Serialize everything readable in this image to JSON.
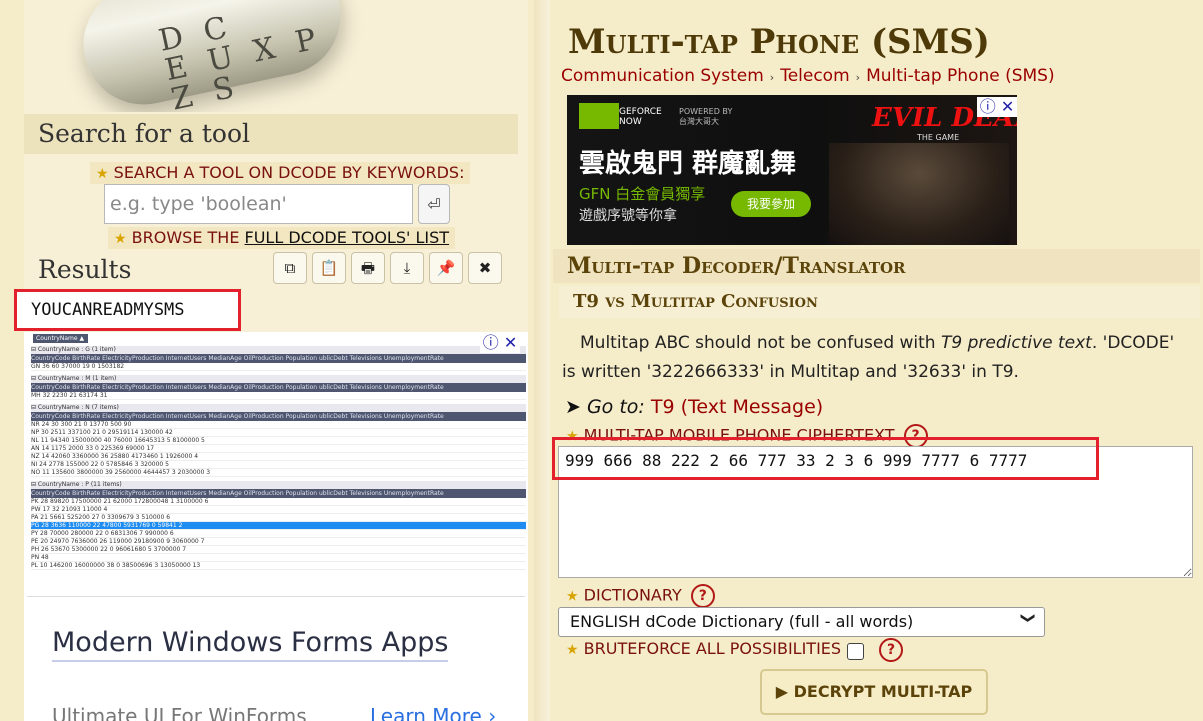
{
  "logo": {
    "letters": "D C\nE U X P\nZ S"
  },
  "search": {
    "section_title": "Search for a tool",
    "keywords_label": "SEARCH A TOOL ON DCODE BY KEYWORDS:",
    "placeholder": "e.g. type 'boolean'",
    "go_icon": "⏎",
    "browse_prefix": "BROWSE THE ",
    "browse_link": "FULL DCODE TOOLS' LIST"
  },
  "results": {
    "section_title": "Results",
    "toolbar_icons": [
      "copy-icon",
      "clipboard-icon",
      "print-icon",
      "download-icon",
      "pin-icon",
      "close-icon"
    ],
    "toolbar_glyphs": [
      "⧉",
      "📋",
      "🖶",
      "⤓",
      "📌",
      "✖"
    ],
    "output": "YOUCANREADMYSMS"
  },
  "ad_left": {
    "dropdown": "CountryName ▲",
    "headers": "CountryCode    BirthRate    ElectricityProduction    InternetUsers    MedianAge    OilProduction    Population    ublicDebt    Televisions    UnemploymentRate",
    "groups": [
      {
        "title": "⊟ CountryName : G (1 item)",
        "rows": [
          "GN        36        60        37000        19        0        1503182"
        ],
        "sel": -1
      },
      {
        "title": "⊟ CountryName : M (1 item)",
        "rows": [
          "MH        32        2230        21        63174        31"
        ],
        "sel": -1
      },
      {
        "title": "⊟ CountryName : N (7 items)",
        "rows": [
          "NR   24   30   300   21   0   13770   500   90",
          "NP   30   2511   337100   21   0   29519114   130000   42",
          "NL   11   94340   15000000   40   76000   16645313   5   8100000   5",
          "AN   14   1175   2000   33   0   225369   69000   17",
          "NZ   14   42060   3360000   36   25880   4173460   1   1926000   4",
          "NI   24   2778   155000   22   0   5785846   3   320000   5",
          "NO   11   135600   3800000   39   2560000   4644457   3   2030000   3"
        ],
        "sel": -1
      },
      {
        "title": "⊟ CountryName : P (11 items)",
        "rows": [
          "PK   28   89820   17500000   21   62000   172800048   1   3100000   6",
          "PW   17   32   21093   11000   4",
          "PA   21   5661   525200   27   0   3309679   3   510000   6",
          "PG   28   3636   110000   22   47800   5931769   0   59841   2",
          "PY   28   70000   280000   22   0   6831306   7   990000   6",
          "PE   20   24970   7636000   26   119000   29180900   9   3060000   7",
          "PH   26   53670   5300000   22   0   96061680   5   3700000   7",
          "PN   48",
          "PL   10   146200   16000000   38   0   38500696   3   13050000   13"
        ],
        "sel": 3
      }
    ],
    "title": "Modern Windows Forms Apps",
    "subtitle": "Ultimate UI For WinForms",
    "more": "Learn More ›",
    "adchoice": "ⓘ ✕"
  },
  "page": {
    "title": "Multi-tap Phone (SMS)",
    "breadcrumb": [
      "Communication System",
      "Telecom",
      "Multi-tap Phone (SMS)"
    ],
    "breadcrumb_sep": "›"
  },
  "ad_right": {
    "brand1": "GEFORCE\nNOW",
    "powered": "POWERED BY\n台灣大哥大",
    "headline": "雲啟鬼門 群魔亂舞",
    "line1": "GFN 白金會員獨享",
    "line2": "遊戲序號等你拿",
    "join": "我要參加",
    "game": "EVIL DEAD",
    "game_sub": "THE GAME",
    "adchoice": "ⓘ ✕"
  },
  "decoder": {
    "section_title": "Multi-tap Decoder/Translator",
    "sub_title": "T9 vs Multitap Confusion",
    "para_1": "Multitap ABC should not be confused with ",
    "para_em": "T9 predictive text",
    "para_2": ". 'DCODE' is written '3222666333' in Multitap and '32633' in T9.",
    "goto_prefix": "➤ Go to: ",
    "goto_link": "T9 (Text Message)",
    "cipher_label": "MULTI-TAP MOBILE PHONE CIPHERTEXT",
    "cipher_value": "999 666 88 222 2 66 777 33 2 3 6 999 7777 6 7777",
    "dict_label": "DICTIONARY",
    "dict_value": "ENGLISH dCode Dictionary (full - all words)",
    "brute_label": "BRUTEFORCE ALL POSSIBILITIES",
    "brute_checked": false,
    "help": "?",
    "decrypt_label": "▶ DECRYPT MULTI-TAP"
  },
  "colors": {
    "accent": "#9a0000",
    "highlight": "#e3212c",
    "background": "#f5ecc9"
  }
}
